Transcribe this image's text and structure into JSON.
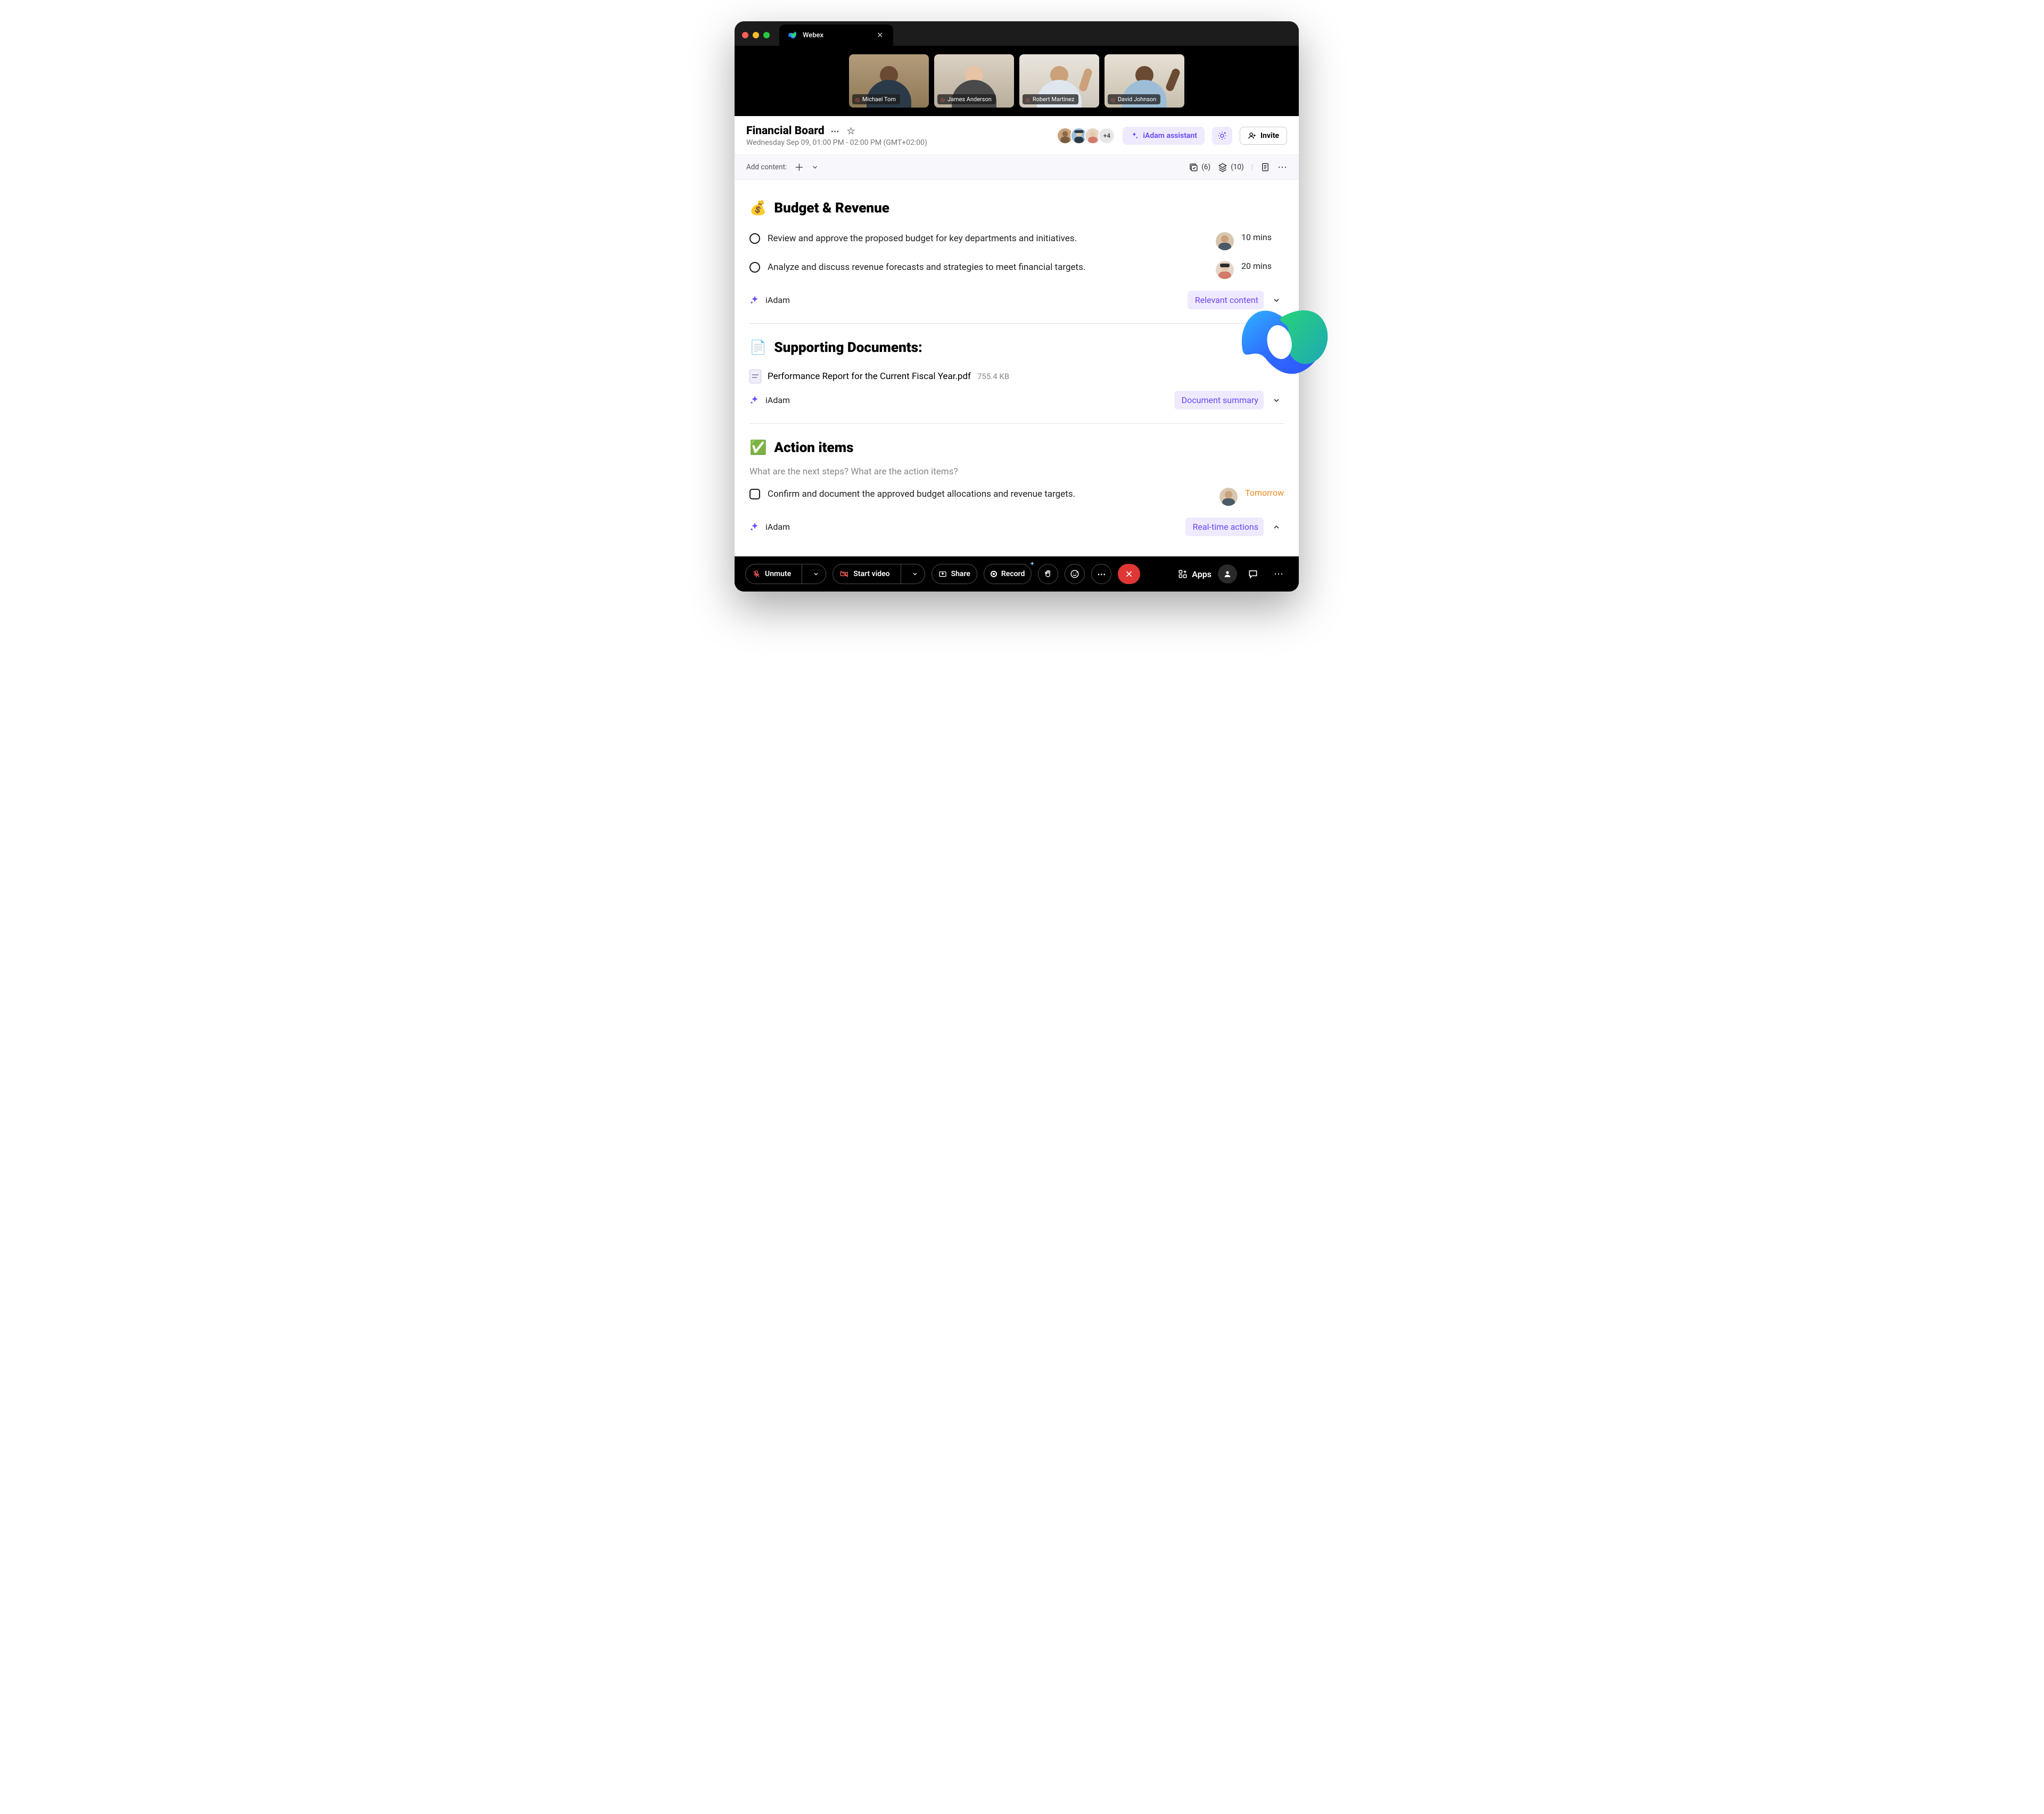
{
  "window": {
    "tab_label": "Webex"
  },
  "participants_video": [
    {
      "name": "Michael Tom",
      "muted": true
    },
    {
      "name": "James Anderson",
      "muted": true
    },
    {
      "name": "Robert Martinez",
      "muted": true
    },
    {
      "name": "David Johnson",
      "muted": true
    }
  ],
  "meeting": {
    "title": "Financial Board",
    "subtitle": "Wednesday Sep 09, 01:00 PM - 02:00 PM (GMT+02:00)",
    "extra_count": "+4",
    "assistant_label": "iAdam assistant",
    "invite_label": "Invite"
  },
  "toolbar": {
    "add_content": "Add content:",
    "count1": "(6)",
    "count2": "(10)"
  },
  "sections": {
    "budget": {
      "emoji": "💰",
      "title": "Budget & Revenue",
      "items": [
        {
          "text": "Review and approve the proposed budget for key departments and initiatives.",
          "duration": "10 mins"
        },
        {
          "text": "Analyze and discuss revenue forecasts and strategies to meet financial targets.",
          "duration": "20 mins"
        }
      ],
      "iadam": "iAdam",
      "pill": "Relevant content",
      "chev_open": false
    },
    "docs": {
      "emoji": "📄",
      "title": "Supporting Documents:",
      "file_name": "Performance Report for the Current Fiscal Year.pdf",
      "file_size": "755.4 KB",
      "iadam": "iAdam",
      "pill": "Document summary",
      "chev_open": false
    },
    "actions": {
      "emoji": "✅",
      "title": "Action items",
      "prompt": "What are the next steps? What are the action items?",
      "item": "Confirm and document the approved budget allocations and revenue targets.",
      "due": "Tomorrow",
      "iadam": "iAdam",
      "pill": "Real-time actions",
      "chev_open": true
    }
  },
  "bottom": {
    "unmute": "Unmute",
    "start_video": "Start video",
    "share": "Share",
    "record": "Record",
    "apps": "Apps"
  }
}
